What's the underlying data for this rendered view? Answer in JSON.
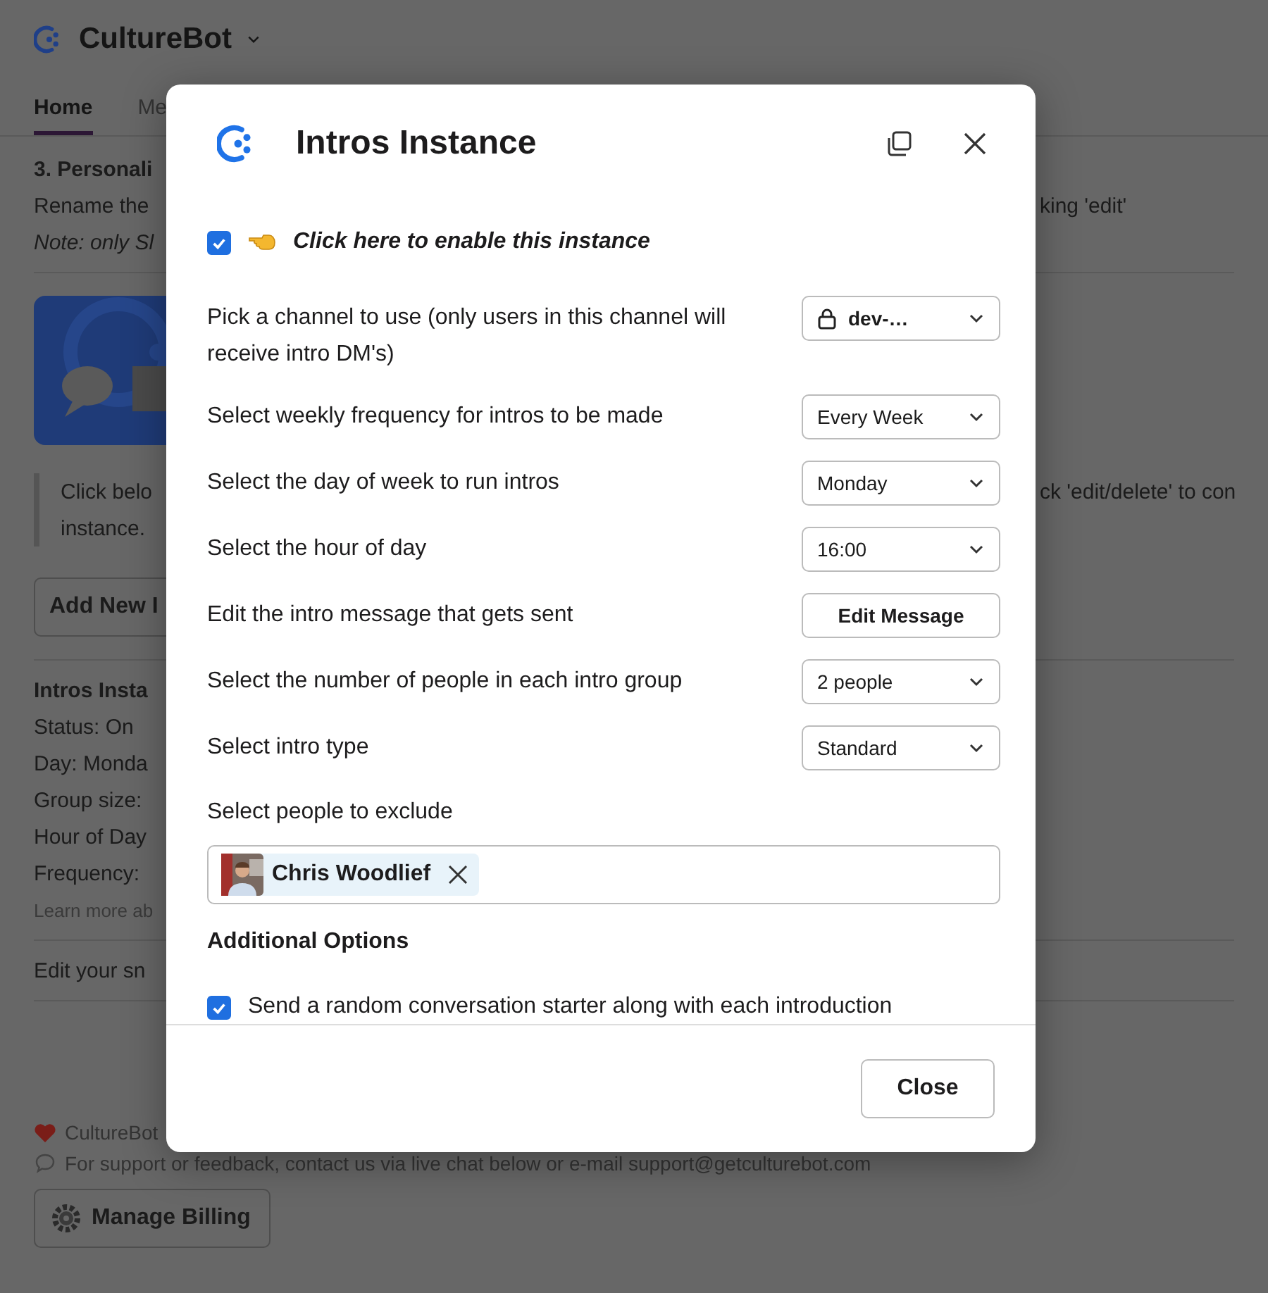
{
  "app": {
    "name": "CultureBot",
    "tabs": [
      {
        "label": "Home",
        "selected": true
      },
      {
        "label": "Me",
        "selected": false
      }
    ]
  },
  "page": {
    "lines": [
      {
        "kind": "heading",
        "left": "3. Personali"
      },
      {
        "kind": "text",
        "left": "Rename the",
        "right": "king 'edit'"
      },
      {
        "kind": "note",
        "left": "Note: only Sl"
      },
      {
        "kind": "divider"
      },
      {
        "kind": "banner"
      },
      {
        "kind": "quote",
        "left": "Click belo",
        "right": "ck 'edit/delete' to con",
        "second": "instance."
      },
      {
        "kind": "button",
        "left": "Add New I"
      },
      {
        "kind": "divider"
      },
      {
        "kind": "heading",
        "left": "Intros Insta"
      },
      {
        "kind": "text",
        "left": "Status: On"
      },
      {
        "kind": "text",
        "left": "Day: Monda"
      },
      {
        "kind": "text",
        "left": "Group size:"
      },
      {
        "kind": "text",
        "left": "Hour of Day"
      },
      {
        "kind": "text",
        "left": "Frequency:"
      },
      {
        "kind": "small",
        "left": "Learn more ab"
      },
      {
        "kind": "divider"
      },
      {
        "kind": "text",
        "left": "Edit your sn"
      },
      {
        "kind": "divider"
      }
    ],
    "footer": {
      "credit": "CultureBot",
      "support": "For support or feedback, contact us via live chat below or e-mail support@getculturebot.com",
      "billing_button": "Manage Billing"
    }
  },
  "modal": {
    "title": "Intros Instance",
    "enable": {
      "label": "Click here to enable this instance",
      "checked": true
    },
    "rows": [
      {
        "label": "Pick a channel to use (only users in this channel will receive intro DM's)",
        "kind": "select",
        "value": "dev-…",
        "locked": true
      },
      {
        "label": "Select weekly frequency for intros to be made",
        "kind": "select",
        "value": "Every Week"
      },
      {
        "label": "Select the day of week to run intros",
        "kind": "select",
        "value": "Monday"
      },
      {
        "label": "Select the hour of day",
        "kind": "select",
        "value": "16:00"
      },
      {
        "label": "Edit the intro message that gets sent",
        "kind": "button",
        "value": "Edit Message"
      },
      {
        "label": "Select the number of people in each intro group",
        "kind": "select",
        "value": "2 people"
      },
      {
        "label": "Select intro type",
        "kind": "select",
        "value": "Standard"
      }
    ],
    "exclude": {
      "label": "Select people to exclude",
      "people": [
        "Chris Woodlief"
      ]
    },
    "additional_heading": "Additional Options",
    "options": [
      {
        "label": "Send a random conversation starter along with each introduction",
        "checked": true
      }
    ],
    "close_button": "Close"
  }
}
